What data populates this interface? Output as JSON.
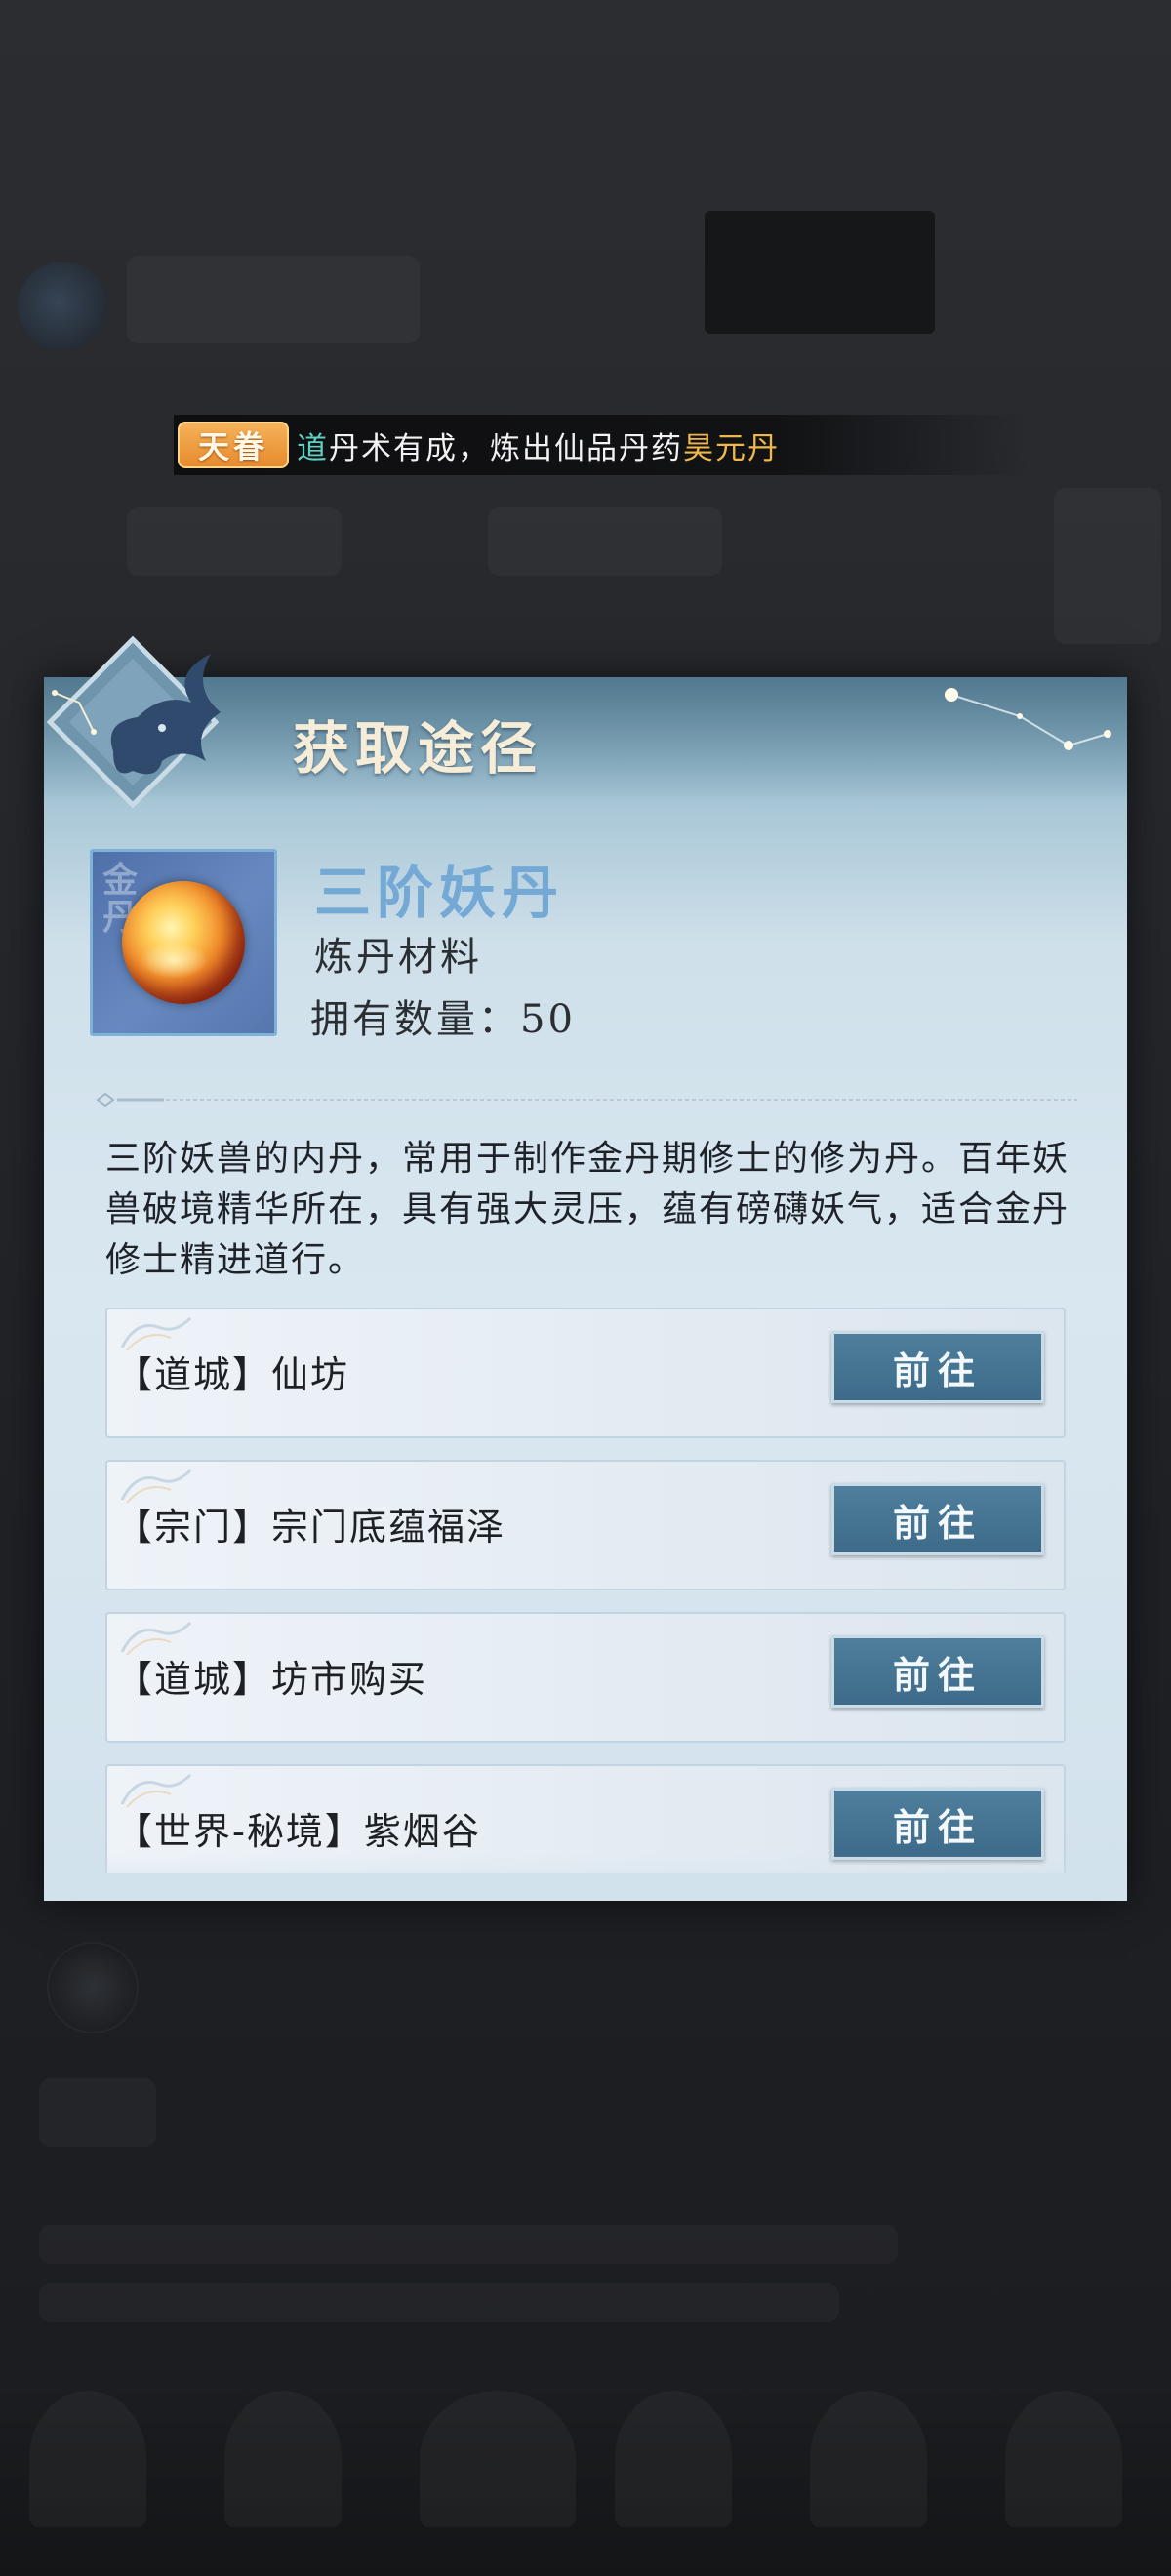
{
  "announcement": {
    "badge": "天眷",
    "prefix": "道",
    "body": "丹术有成，炼出仙品丹药",
    "item": "昊元丹"
  },
  "dialog": {
    "title": "获取途径",
    "item": {
      "icon": "golden-core-orb-icon",
      "tag": "金丹",
      "name": "三阶妖丹",
      "type": "炼丹材料",
      "count_label": "拥有数量：",
      "count_value": "50"
    },
    "description": "三阶妖兽的内丹，常用于制作金丹期修士的修为丹。百年妖兽破境精华所在，具有强大灵压，蕴有磅礴妖气，适合金丹修士精进道行。",
    "sources": [
      {
        "label": "【道城】仙坊",
        "button": "前往"
      },
      {
        "label": "【宗门】宗门底蕴福泽",
        "button": "前往"
      },
      {
        "label": "【道城】坊市购买",
        "button": "前往"
      },
      {
        "label": "【世界-秘境】紫烟谷",
        "button": "前往"
      }
    ]
  },
  "colors": {
    "panel_top": "#6f9bb0",
    "panel_body": "#d9e7f0",
    "item_name": "#74a9d6",
    "go_button": "#3d6a89",
    "badge": "#e68a2e",
    "highlight_gold": "#f0b84a",
    "highlight_green": "#5fd0c4"
  }
}
